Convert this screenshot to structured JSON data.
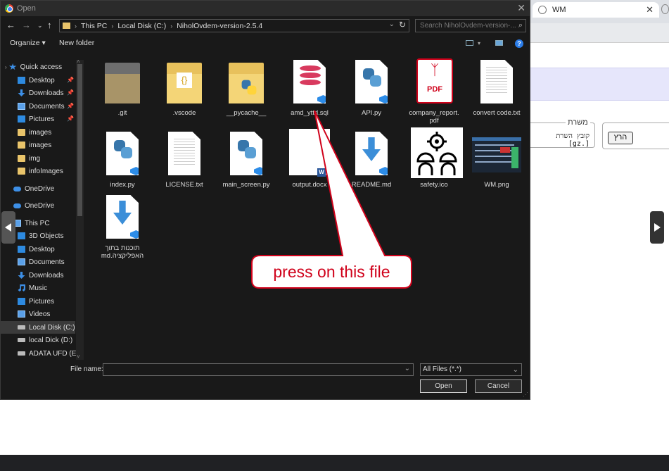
{
  "background": {
    "tab_title": "WM",
    "legend": "משרת",
    "field_text": "קובץ השרת [.gz]",
    "run_button": "הרץ"
  },
  "dialog": {
    "title": "Open",
    "breadcrumbs": [
      "This PC",
      "Local Disk (C:)",
      "NiholOvdem-version-2.5.4"
    ],
    "search_placeholder": "Search NiholOvdem-version-...",
    "organize": "Organize",
    "new_folder": "New folder",
    "nav": {
      "quick_access": "Quick access",
      "desktop": "Desktop",
      "downloads": "Downloads",
      "documents": "Documents",
      "pictures": "Pictures",
      "images1": "images",
      "images2": "images",
      "img": "img",
      "infoimages": "infoImages",
      "onedrive1": "OneDrive",
      "onedrive2": "OneDrive",
      "this_pc": "This PC",
      "objects3d": "3D Objects",
      "pc_desktop": "Desktop",
      "pc_documents": "Documents",
      "pc_downloads": "Downloads",
      "music": "Music",
      "pc_pictures": "Pictures",
      "videos": "Videos",
      "local_c": "Local Disk (C:)",
      "local_d": "local Dick (D:)",
      "adata": "ADATA UFD (E:)"
    },
    "files": [
      ".git",
      ".vscode",
      "__pycache__",
      "amd_yttd.sql",
      "API.py",
      "company_report.\npdf",
      "convert code.txt",
      "index.py",
      "LICENSE.txt",
      "main_screen.py",
      "output.docx",
      "README.md",
      "safety.ico",
      "WM.png",
      "תוכנות בתוך\nהאפליקציה.md"
    ],
    "icons": {
      "pdf_text": "PDF",
      "word_letter": "W"
    },
    "file_name_label": "File name:",
    "file_name_value": "",
    "file_type": "All Files (*.*)",
    "open_button": "Open",
    "cancel_button": "Cancel"
  },
  "annotation": {
    "text": "press on this file",
    "color": "#d0021b"
  }
}
